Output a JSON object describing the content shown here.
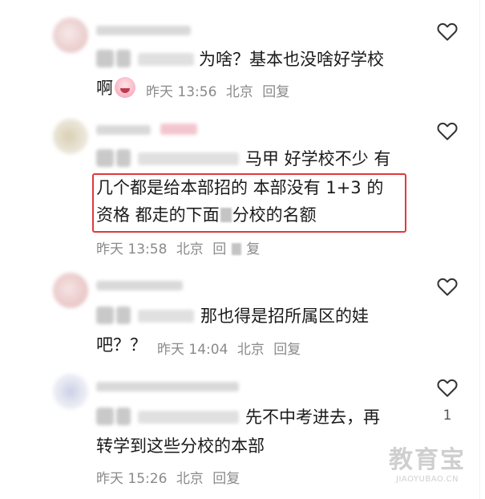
{
  "comments": [
    {
      "line1": "为啥？基本也没啥好学校",
      "line2": "啊",
      "time": "昨天 13:56",
      "location": "北京",
      "reply": "回复"
    },
    {
      "line1": "马甲  好学校不少 有",
      "line2": "几个都是给本部招的 本部没有 1+3 的",
      "line3a": "资格 都走的下面",
      "line3b": "分校的名额",
      "time": "昨天 13:58",
      "location": "北京",
      "reply_a": "回",
      "reply_b": "复"
    },
    {
      "line1": "那也得是招所属区的娃",
      "line2": "吧？？",
      "time": "昨天 14:04",
      "location": "北京",
      "reply": "回复"
    },
    {
      "line1": "先不中考进去，再",
      "line2": "转学到这些分校的本部",
      "time": "昨天 15:26",
      "location": "北京",
      "reply": "回复",
      "likes": "1"
    }
  ],
  "watermark": {
    "main": "教育宝",
    "sub": "JIAOYUBAO.CN"
  },
  "colors": {
    "highlight": "#e0393e",
    "meta": "#8a8a8a",
    "text": "#1a1a1a"
  }
}
